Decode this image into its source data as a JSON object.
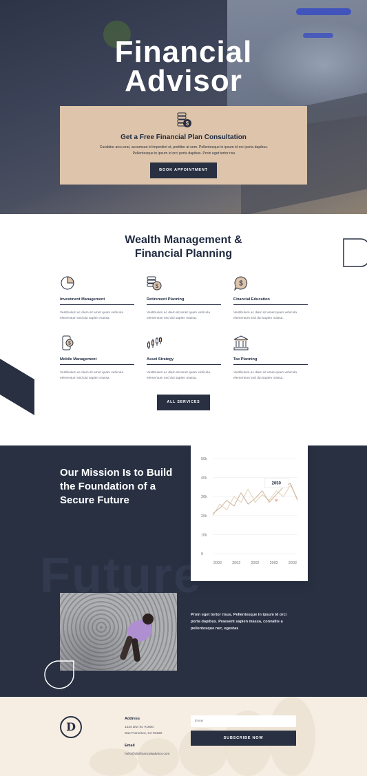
{
  "hero": {
    "title_line1": "Financial",
    "title_line2": "Advisor",
    "cta": {
      "icon": "coins-dollar-icon",
      "title": "Get a Free Financial Plan Consultation",
      "body": "Curabitur arcu erat, accumsan id imperdiet et, porttitor at sem. Pellentesque in ipsum id orci porta dapibus. Pellentesque in ipsum id orci porta dapibus. Proin eget tortor risu",
      "button_label": "BOOK APPOINTMENT"
    }
  },
  "services": {
    "title_line1": "Wealth Management &",
    "title_line2": "Financial Planning",
    "items": [
      {
        "icon": "pie-chart-icon",
        "title": "Investment Management",
        "desc": "Vestibulum ac diam sit amet quam vehicula elementum sed dui sapien massa."
      },
      {
        "icon": "coins-stack-icon",
        "title": "Retirement Planning",
        "desc": "Vestibulum ac diam sit amet quam vehicula elementum sed dui sapien massa."
      },
      {
        "icon": "dollar-bubble-icon",
        "title": "Financial Education",
        "desc": "Vestibulum ac diam sit amet quam vehicula elementum sed dui sapien massa."
      },
      {
        "icon": "mobile-dollar-icon",
        "title": "Mobile Management",
        "desc": "Vestibulum ac diam sit amet quam vehicula elementum sed dui sapien massa."
      },
      {
        "icon": "candlestick-icon",
        "title": "Asset Strategy",
        "desc": "Vestibulum ac diam sit amet quam vehicula elementum sed dui sapien massa."
      },
      {
        "icon": "bank-building-icon",
        "title": "Tax Planning",
        "desc": "Vestibulum ac diam sit amet quam vehicula elementum sed dui sapien massa."
      }
    ],
    "button_label": "ALL SERVICES"
  },
  "mission": {
    "title": "Our Mission Is to Build the Foundation of a Secure Future",
    "watermark": "Future",
    "text": "Proin eget tortor risus. Pellentesque in ipsum id orci porta dapibus. Praesent sapien massa, convallis a pellentesque nec, egestas"
  },
  "chart_data": {
    "type": "line",
    "x": [
      "2002",
      "2002",
      "2002",
      "2002",
      "2002"
    ],
    "yticks": [
      "0",
      "10k",
      "20k",
      "30k",
      "40k",
      "50k"
    ],
    "ylim": [
      0,
      50000
    ],
    "tooltip": "2050",
    "grid": true,
    "colors": {
      "line1": "#e4cfb8",
      "line2": "#cbb49b",
      "marker": "#f2b9a6"
    },
    "series": [
      {
        "values": [
          20000,
          26000,
          23000,
          30000,
          27000,
          34000,
          27000,
          31000,
          28000,
          33000,
          30000,
          36000,
          29000
        ]
      },
      {
        "values": [
          21000,
          24000,
          28000,
          25000,
          32000,
          26000,
          29000,
          33000,
          27000,
          31000,
          35000,
          37000,
          28000
        ]
      }
    ]
  },
  "footer": {
    "logo_letter": "D",
    "address_label": "Address",
    "address_line1": "1234 Divi St. #1000",
    "address_line2": "San Francisco, CA 94220",
    "email_label": "Email",
    "email_value": "hello@divifinancialadvisor.com",
    "email_placeholder": "Email",
    "subscribe_label": "SUBSCRIBE NOW"
  },
  "colors": {
    "navy": "#283042",
    "tan": "#ddc4aa",
    "cream": "#f6ede3"
  }
}
